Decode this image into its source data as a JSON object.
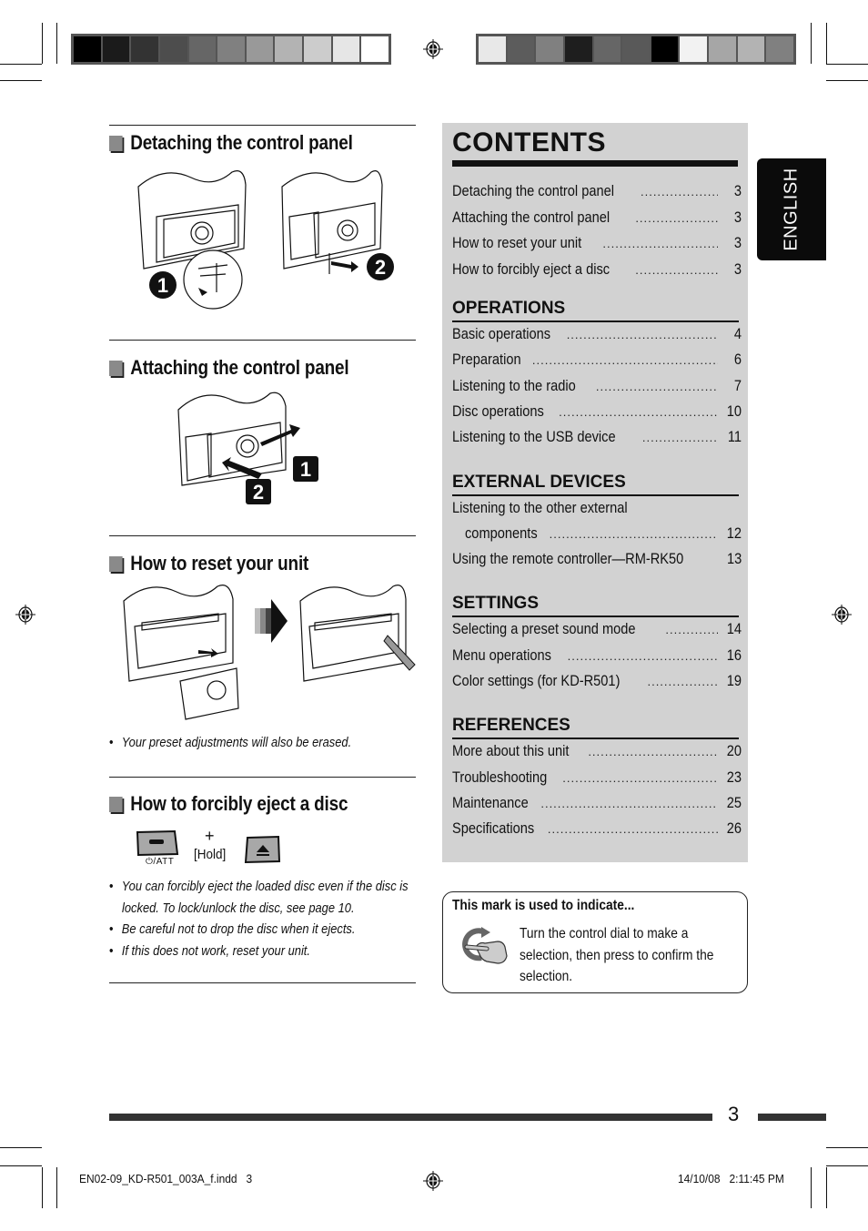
{
  "color_bars": {
    "left": [
      "#000000",
      "#1b1b1b",
      "#333333",
      "#4d4d4d",
      "#666666",
      "#808080",
      "#999999",
      "#b3b3b3",
      "#cccccc",
      "#e6e6e6",
      "#ffffff"
    ],
    "right": [
      "#e8e8e8",
      "#5c5c5c",
      "#808080",
      "#1e1e1e",
      "#666666",
      "#595959",
      "#000000",
      "#f2f2f2",
      "#a6a6a6",
      "#b3b3b3",
      "#808080"
    ]
  },
  "left_column": {
    "sections": [
      {
        "title": "Detaching the control panel",
        "step_labels": [
          "1",
          "2"
        ]
      },
      {
        "title": "Attaching the control panel",
        "step_labels": [
          "1",
          "2"
        ]
      },
      {
        "title": "How to reset your unit",
        "notes": [
          "Your preset adjustments will also be erased."
        ]
      },
      {
        "title": "How to forcibly eject a disc",
        "button_label": "⏻/ATT",
        "plus": "+",
        "hold": "[Hold]",
        "notes": [
          "You can forcibly eject the loaded disc even if the disc is",
          "locked. To lock/unlock the disc, see page 10.",
          "Be careful not to drop the disc when it ejects.",
          "If this does not work, reset your unit."
        ]
      }
    ]
  },
  "contents": {
    "title": "CONTENTS",
    "intro_items": [
      {
        "label": "Detaching the control panel",
        "page": "3"
      },
      {
        "label": "Attaching the control panel",
        "page": "3"
      },
      {
        "label": "How to reset your unit",
        "page": "3"
      },
      {
        "label": "How to forcibly eject a disc",
        "page": "3"
      }
    ],
    "categories": [
      {
        "name": "OPERATIONS",
        "items": [
          {
            "label": "Basic operations",
            "page": "4"
          },
          {
            "label": "Preparation",
            "page": "6"
          },
          {
            "label": "Listening to the radio",
            "page": "7"
          },
          {
            "label": "Disc operations",
            "page": "10"
          },
          {
            "label": "Listening to the USB device",
            "page": "11"
          }
        ]
      },
      {
        "name": "EXTERNAL DEVICES",
        "items": [
          {
            "label": "Listening to the other external",
            "page": ""
          },
          {
            "label": "components",
            "page": "12"
          },
          {
            "label": "Using the remote controller—RM-RK50",
            "page": "13"
          }
        ]
      },
      {
        "name": "SETTINGS",
        "items": [
          {
            "label": "Selecting a preset sound mode",
            "page": "14"
          },
          {
            "label": "Menu operations",
            "page": "16"
          },
          {
            "label": "Color settings (for KD-R501)",
            "page": "19"
          }
        ]
      },
      {
        "name": "REFERENCES",
        "items": [
          {
            "label": "More about this unit",
            "page": "20"
          },
          {
            "label": "Troubleshooting",
            "page": "23"
          },
          {
            "label": "Maintenance",
            "page": "25"
          },
          {
            "label": "Specifications",
            "page": "26"
          }
        ]
      }
    ]
  },
  "language_tab": "ENGLISH",
  "mark_box": {
    "title": "This mark is used to indicate...",
    "description": "Turn the control dial to make a selection, then press to confirm the selection."
  },
  "footer": {
    "page_number": "3",
    "file_slug": "EN02-09_KD-R501_003A_f.indd   3",
    "timestamp": "14/10/08   2:11:45 PM"
  }
}
